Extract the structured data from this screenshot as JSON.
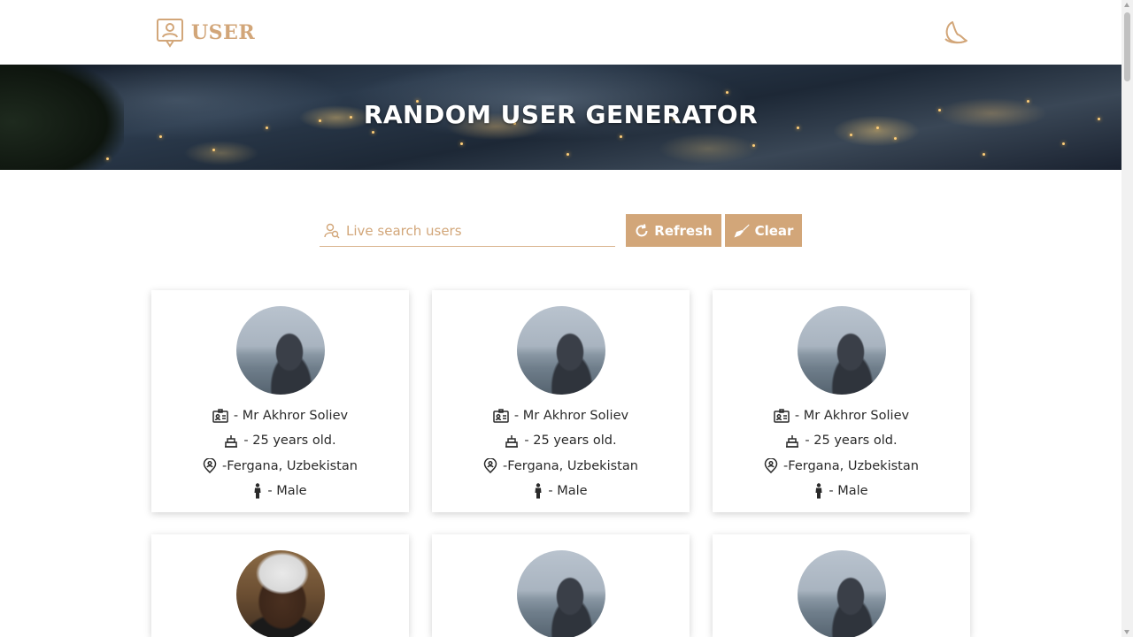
{
  "header": {
    "logo_text": "USER"
  },
  "hero": {
    "title": "RANDOM USER GENERATOR"
  },
  "search": {
    "placeholder": "Live search users",
    "value": ""
  },
  "buttons": {
    "refresh": "Refresh",
    "clear": "Clear"
  },
  "users": [
    {
      "name": "- Mr Akhror Soliev",
      "age": "- 25 years old.",
      "location": "-Fergana, Uzbekistan",
      "gender": "- Male"
    },
    {
      "name": "- Mr Akhror Soliev",
      "age": "- 25 years old.",
      "location": "-Fergana, Uzbekistan",
      "gender": "- Male"
    },
    {
      "name": "- Mr Akhror Soliev",
      "age": "- 25 years old.",
      "location": "-Fergana, Uzbekistan",
      "gender": "- Male"
    }
  ],
  "colors": {
    "accent": "#d2a679",
    "text": "#2a2a2a"
  }
}
